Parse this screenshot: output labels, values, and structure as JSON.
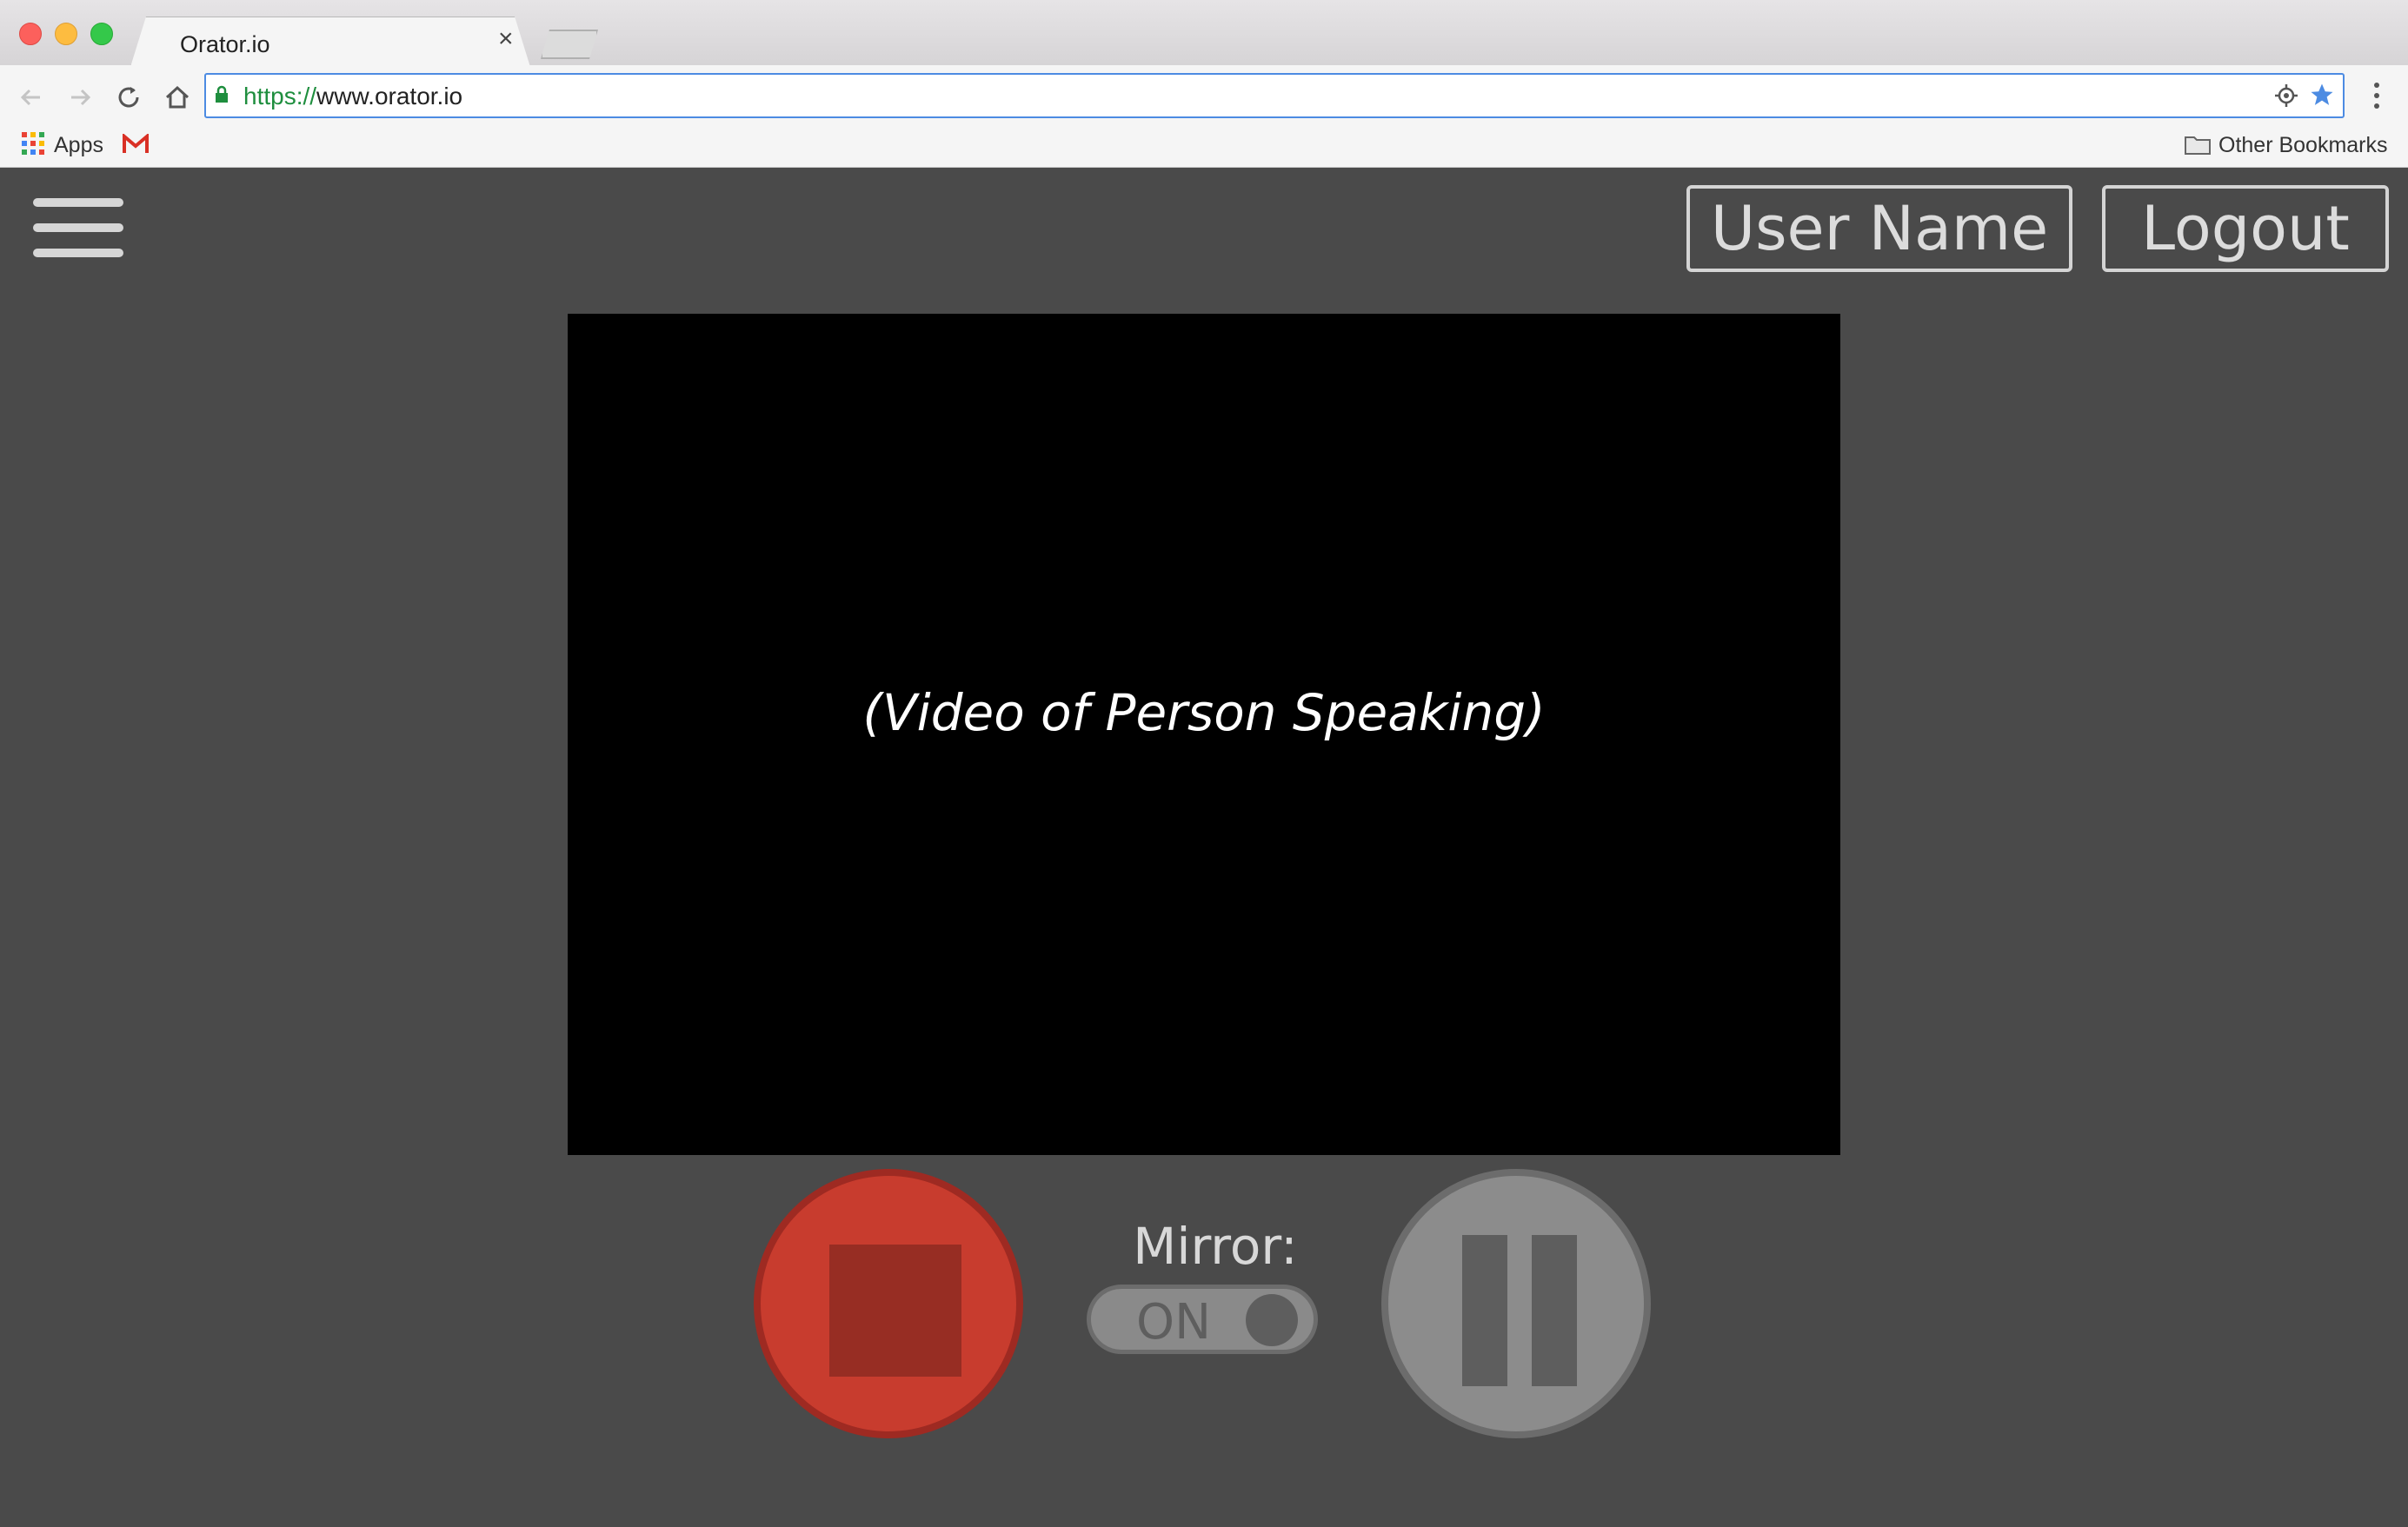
{
  "browser": {
    "tab_title": "Orator.io",
    "tab_close": "×",
    "url_scheme": "https://",
    "url_host": "www.orator.io",
    "bookmarks": {
      "apps_label": "Apps",
      "other_label": "Other Bookmarks"
    }
  },
  "header": {
    "user_button": "User Name",
    "logout_button": "Logout"
  },
  "video": {
    "caption": "(Video of Person Speaking)"
  },
  "controls": {
    "mirror_label": "Mirror:",
    "mirror_state": "ON"
  },
  "colors": {
    "background": "#4a4a4a",
    "record": "#c83c2e",
    "record_inner": "#972d23",
    "control_gray": "#8c8c8c",
    "control_dark": "#5e5e5e",
    "accent_blue": "#4c8be2"
  },
  "icons": {
    "menu": "hamburger-icon",
    "record": "stop-square-icon",
    "pause": "pause-icon",
    "toggle": "toggle-knob-icon"
  }
}
